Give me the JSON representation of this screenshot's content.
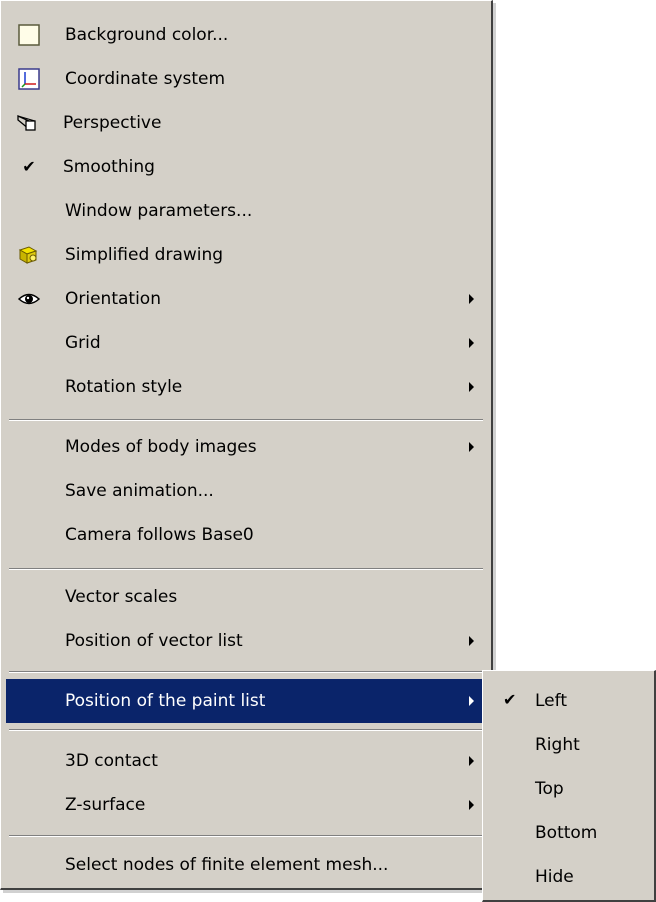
{
  "menu": {
    "items": [
      {
        "label": "Background color...",
        "icon": "color-swatch-icon",
        "has_submenu": false
      },
      {
        "label": "Coordinate system",
        "icon": "axes-icon",
        "has_submenu": false
      },
      {
        "label": "Perspective",
        "icon": "perspective-icon",
        "has_submenu": false
      },
      {
        "label": "Smoothing",
        "icon": "check-icon",
        "checked": true,
        "has_submenu": false
      },
      {
        "label": "Window parameters...",
        "has_submenu": false
      },
      {
        "label": "Simplified drawing",
        "icon": "simplified-drawing-icon",
        "has_submenu": false
      },
      {
        "label": "Orientation",
        "icon": "eye-icon",
        "has_submenu": true
      },
      {
        "label": "Grid",
        "has_submenu": true
      },
      {
        "label": "Rotation style",
        "has_submenu": true
      },
      {
        "label": "Modes of body images",
        "has_submenu": true
      },
      {
        "label": "Save animation...",
        "has_submenu": false
      },
      {
        "label": "Camera follows Base0",
        "has_submenu": false
      },
      {
        "label": "Vector scales",
        "has_submenu": false
      },
      {
        "label": "Position of vector list",
        "has_submenu": true
      },
      {
        "label": "Position of the paint list",
        "has_submenu": true,
        "highlighted": true
      },
      {
        "label": "3D contact",
        "has_submenu": true
      },
      {
        "label": "Z-surface",
        "has_submenu": true
      },
      {
        "label": "Select nodes of finite element mesh...",
        "has_submenu": false
      }
    ]
  },
  "submenu": {
    "items": [
      {
        "label": "Left",
        "checked": true
      },
      {
        "label": "Right",
        "checked": false
      },
      {
        "label": "Top",
        "checked": false
      },
      {
        "label": "Bottom",
        "checked": false
      },
      {
        "label": "Hide",
        "checked": false
      }
    ]
  },
  "colors": {
    "menu_bg": "#d4d0c8",
    "highlight_bg": "#0a246a",
    "highlight_text": "#ffffff"
  }
}
